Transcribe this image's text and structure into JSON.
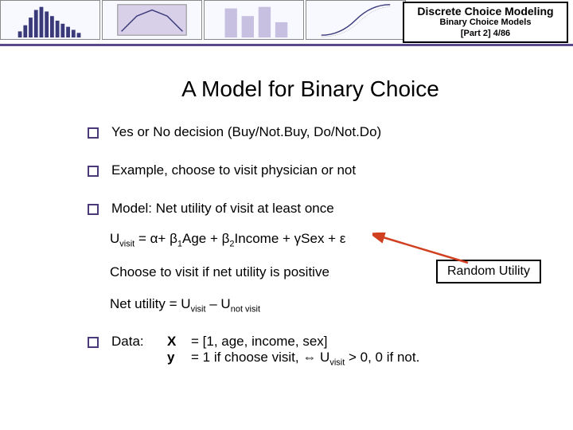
{
  "header": {
    "title": "Discrete Choice Modeling",
    "subtitle": "Binary Choice Models",
    "part": "[Part 2]  4/86"
  },
  "slide": {
    "title": "A Model for Binary Choice",
    "b1": "Yes or No decision (Buy/Not.Buy, Do/Not.Do)",
    "b2": "Example, choose to visit physician or not",
    "b3": "Model:  Net utility of visit at least once",
    "eq_lhs": "U",
    "eq_sub": "visit",
    "eq_mid": "   =  α+ β",
    "eq_b1sub": "1",
    "eq_age": "Age + β",
    "eq_b2sub": "2",
    "eq_rest": "Income + γSex + ε",
    "choose": "Choose to visit if net utility is positive",
    "random_utility": "Random Utility",
    "net_lhs": "Net utility = U",
    "net_sub1": "visit",
    "net_mid": " – U",
    "net_sub2": "not visit",
    "b4_label": "Data:",
    "b4_x": "X",
    "b4_xdef": "= [1, age, income, sex]",
    "b4_y": "y",
    "b4_ydef_a": "= 1 if choose visit,  ⇔  U",
    "b4_ydef_sub": "visit",
    "b4_ydef_b": " > 0, 0 if not."
  }
}
